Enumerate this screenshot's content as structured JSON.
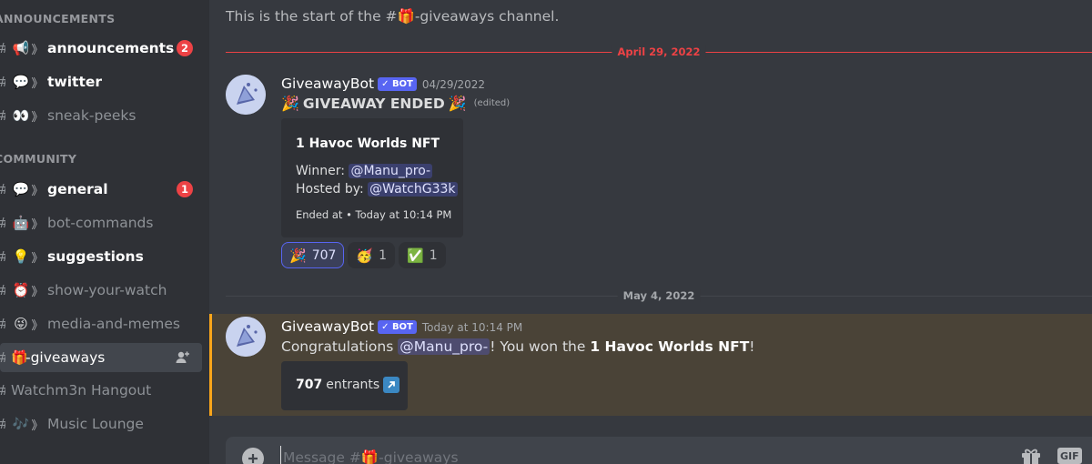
{
  "sidebar": {
    "categories": [
      {
        "label": "ANNOUNCEMENTS"
      },
      {
        "label": "COMMUNITY"
      }
    ],
    "channels": [
      {
        "name": "announcements",
        "emoji": "📢",
        "badge": "2"
      },
      {
        "name": "twitter",
        "emoji": "💬"
      },
      {
        "name": "sneak-peeks",
        "emoji": "👀"
      },
      {
        "name": "general",
        "emoji": "💬",
        "badge": "1"
      },
      {
        "name": "bot-commands",
        "emoji": "🤖"
      },
      {
        "name": "suggestions",
        "emoji": "💡"
      },
      {
        "name": "show-your-watch",
        "emoji": "⏰"
      },
      {
        "name": "media-and-memes",
        "emoji": "😜"
      },
      {
        "name": "-giveaways",
        "emoji": "🎁"
      },
      {
        "name": "Watchm3n Hangout"
      },
      {
        "name": "Music Lounge",
        "emoji": "🎶"
      }
    ]
  },
  "main": {
    "channel_start": "This is the start of the #🎁-giveaways channel.",
    "date_dividers": [
      "April 29, 2022",
      "May 4, 2022"
    ],
    "messages": [
      {
        "author": "GiveawayBot",
        "bot_label": "✓ BOT",
        "timestamp": "04/29/2022",
        "title": "GIVEAWAY ENDED",
        "title_emoji": "🎉",
        "edited": "(edited)",
        "embed": {
          "title": "1 Havoc Worlds NFT",
          "winner_label": "Winner:",
          "winner": "@Manu_pro-",
          "host_label": "Hosted by:",
          "host": "@WatchG33k",
          "footer": "Ended at • Today at 10:14 PM"
        },
        "reactions": [
          {
            "emoji": "🎉",
            "count": "707",
            "me": true
          },
          {
            "emoji": "🥳",
            "count": "1"
          },
          {
            "emoji": "✅",
            "count": "1"
          }
        ]
      },
      {
        "author": "GiveawayBot",
        "bot_label": "✓ BOT",
        "timestamp": "Today at 10:14 PM",
        "text_before": "Congratulations ",
        "mention": "@Manu_pro-",
        "text_middle": "! You won the ",
        "prize": "1 Havoc Worlds NFT",
        "text_after": "!",
        "entrants_count": "707",
        "entrants_label": "entrants"
      }
    ]
  },
  "composer": {
    "placeholder": "Message #🎁-giveaways",
    "gif_label": "GIF"
  },
  "colors": {
    "accent": "#5865f2",
    "badge": "#ed4245",
    "highlight": "#faa61a"
  }
}
